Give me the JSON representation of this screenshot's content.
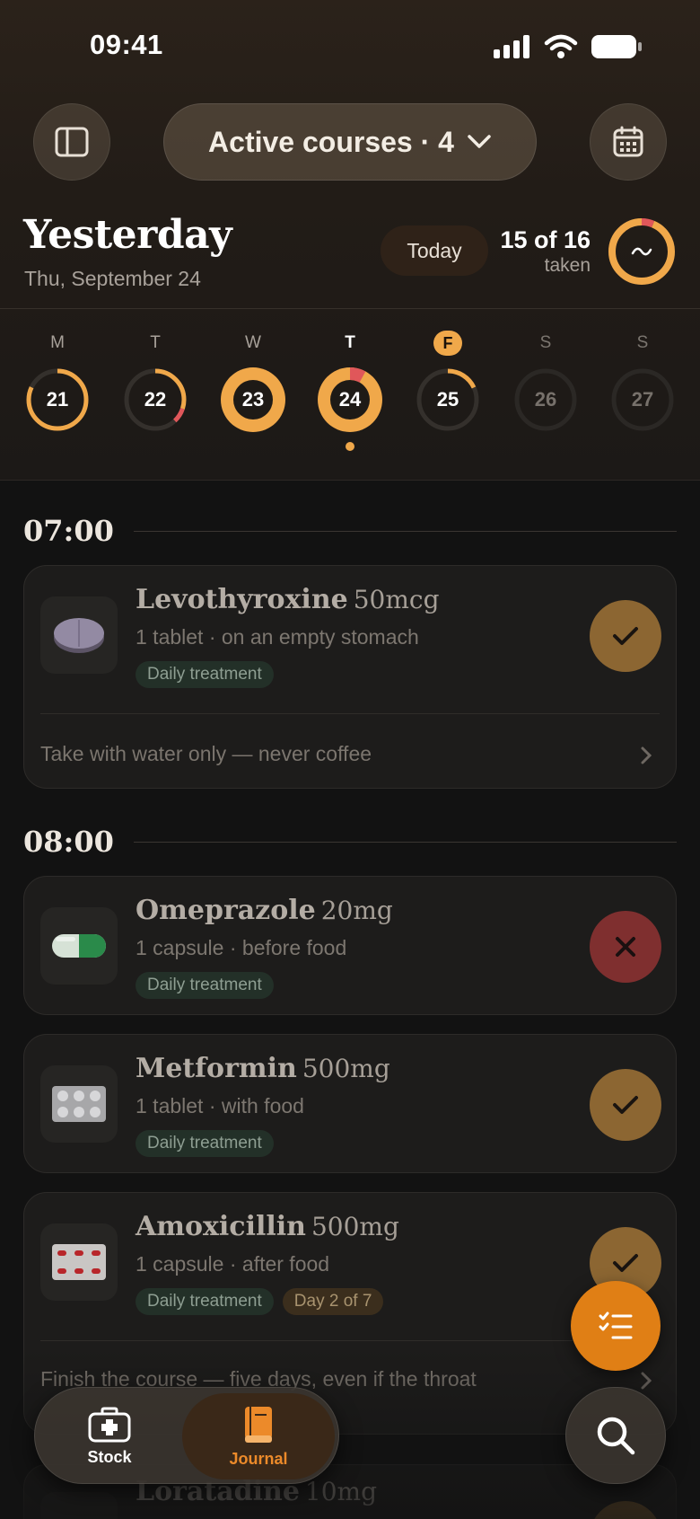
{
  "status_bar": {
    "time": "09:41"
  },
  "nav": {
    "course_selector": "Active courses · 4"
  },
  "header": {
    "title": "Yesterday",
    "date": "Thu, September 24",
    "today_button": "Today",
    "taken_count": "15 of 16",
    "taken_label": "taken",
    "taken_fraction": 0.9375
  },
  "week": [
    {
      "letter": "M",
      "day": "21",
      "progress": 0.82,
      "red_segment": 0,
      "style": "ring"
    },
    {
      "letter": "T",
      "day": "22",
      "progress": 0.3,
      "red_segment": 0.08,
      "style": "ring"
    },
    {
      "letter": "W",
      "day": "23",
      "progress": 1.0,
      "red_segment": 0,
      "style": "full"
    },
    {
      "letter": "T",
      "day": "24",
      "progress": 1.0,
      "red_segment": 0.08,
      "style": "full-selected"
    },
    {
      "letter": "F",
      "day": "25",
      "progress": 0.18,
      "red_segment": 0,
      "style": "today"
    },
    {
      "letter": "S",
      "day": "26",
      "progress": 0,
      "red_segment": 0,
      "style": "future"
    },
    {
      "letter": "S",
      "day": "27",
      "progress": 0,
      "red_segment": 0,
      "style": "future"
    }
  ],
  "schedule": {
    "slot1_time": "07:00",
    "slot2_time": "08:00",
    "meds": [
      {
        "name": "Levothyroxine",
        "dose": "50mcg",
        "instructions": "1 tablet · on an empty stomach",
        "tags": [
          "Daily treatment"
        ],
        "status": "taken",
        "note": "Take with water only — never coffee",
        "icon": "round-pill-icon"
      },
      {
        "name": "Omeprazole",
        "dose": "20mg",
        "instructions": "1 capsule · before food",
        "tags": [
          "Daily treatment"
        ],
        "status": "skipped",
        "icon": "capsule-icon"
      },
      {
        "name": "Metformin",
        "dose": "500mg",
        "instructions": "1 tablet · with food",
        "tags": [
          "Daily treatment"
        ],
        "status": "taken",
        "icon": "blister-pack-icon"
      },
      {
        "name": "Amoxicillin",
        "dose": "500mg",
        "instructions": "1 capsule · after food",
        "tags": [
          "Daily treatment",
          "Day 2 of 7"
        ],
        "status": "taken",
        "note": "Finish the course — five days, even if the throat",
        "icon": "red-blister-icon"
      },
      {
        "name": "Loratadine",
        "dose": "10mg"
      }
    ]
  },
  "tabbar": {
    "stock_label": "Stock",
    "journal_label": "Journal"
  },
  "colors": {
    "accent": "#f0a84a",
    "missed": "#e0575a",
    "taken_button": "#8c6632",
    "skipped_button": "#7f2f2f",
    "fab": "#e07f15"
  }
}
